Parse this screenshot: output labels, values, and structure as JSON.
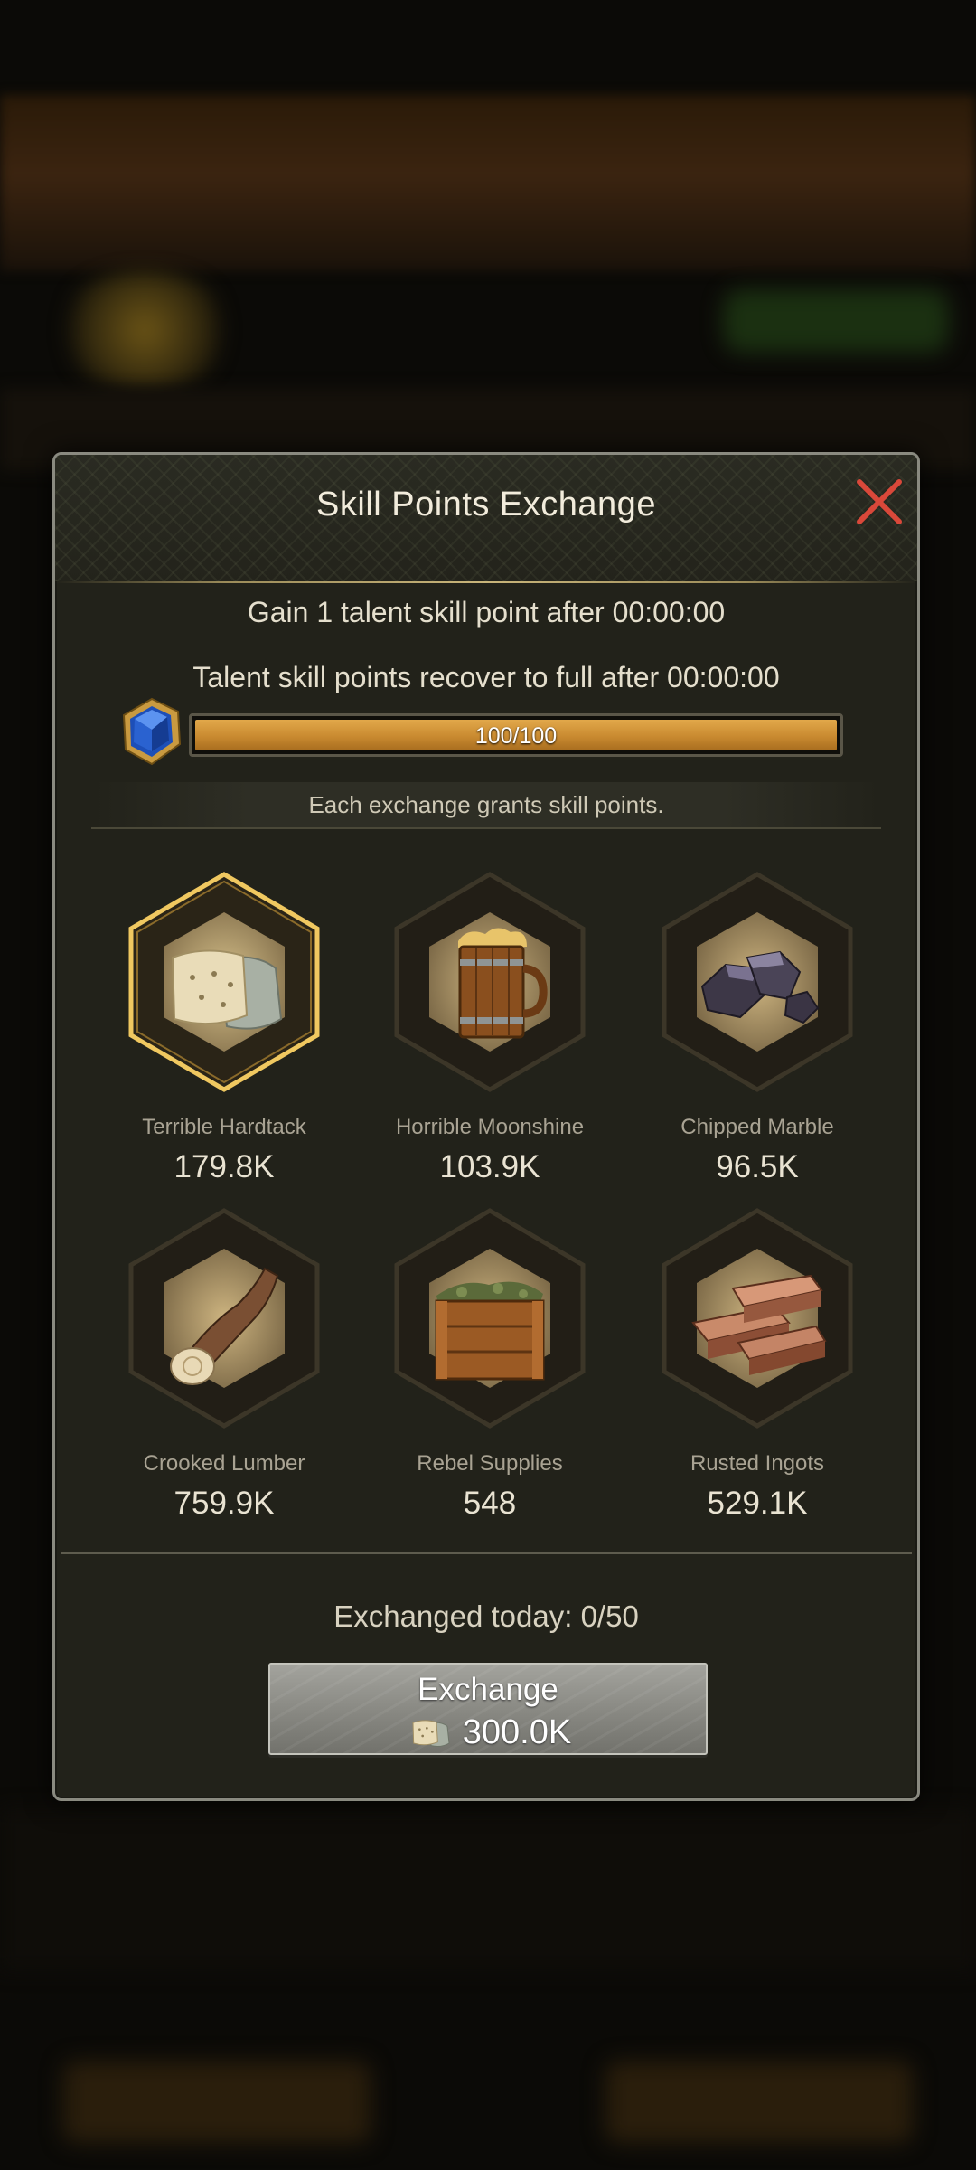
{
  "dialog": {
    "title": "Skill Points Exchange",
    "gain_text": "Gain 1 talent skill point after 00:00:00",
    "recover_text": "Talent skill points recover to full after 00:00:00",
    "progress": {
      "label": "100/100",
      "value": 100,
      "max": 100
    },
    "notice": "Each exchange grants skill points.",
    "exchanged_today": "Exchanged today: 0/50",
    "exchange_button": {
      "label": "Exchange",
      "cost": "300.0K"
    }
  },
  "items": [
    {
      "name": "Terrible Hardtack",
      "count": "179.8K",
      "icon": "hardtack-icon",
      "selected": true
    },
    {
      "name": "Horrible Moonshine",
      "count": "103.9K",
      "icon": "moonshine-mug-icon",
      "selected": false
    },
    {
      "name": "Chipped Marble",
      "count": "96.5K",
      "icon": "marble-rocks-icon",
      "selected": false
    },
    {
      "name": "Crooked Lumber",
      "count": "759.9K",
      "icon": "lumber-log-icon",
      "selected": false
    },
    {
      "name": "Rebel Supplies",
      "count": "548",
      "icon": "supply-crate-icon",
      "selected": false
    },
    {
      "name": "Rusted Ingots",
      "count": "529.1K",
      "icon": "copper-ingots-icon",
      "selected": false
    }
  ],
  "colors": {
    "accent_gold": "#e2b85a",
    "close_red": "#d9483a",
    "progress_fill": "#d59a3c"
  }
}
